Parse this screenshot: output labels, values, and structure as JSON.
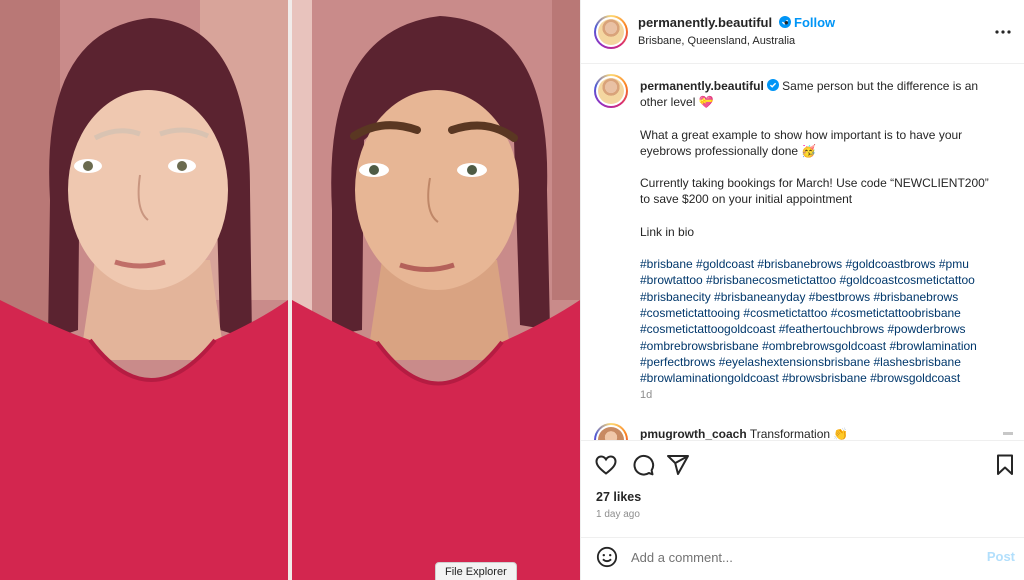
{
  "post": {
    "username": "permanently.beautiful",
    "follow_label": "Follow",
    "dot": "•",
    "location": "Brisbane, Queensland, Australia"
  },
  "caption": {
    "username": "permanently.beautiful",
    "line1": "Same person but the difference is an other level 💝",
    "line2": "What a great example to show how important is to have your eyebrows professionally done 🥳",
    "line3": "Currently taking bookings for March! Use code “NEWCLIENT200” to save $200 on your initial appointment",
    "line4": "Link in bio",
    "hashtags": "#brisbane #goldcoast #brisbanebrows #goldcoastbrows #pmu #browtattoo #brisbanecosmetictattoo #goldcoastcosmetictattoo #brisbanecity #brisbaneanyday #bestbrows #brisbanebrows #cosmetictattooing #cosmetictattoo #cosmetictattoobrisbane #cosmetictattoogoldcoast #feathertouchbrows #powderbrows #ombrebrowsbrisbane #ombrebrowsgoldcoast #browlamination #perfectbrows #eyelashextensionsbrisbane #lashesbrisbane #browlaminationgoldcoast #browsbrisbane #browsgoldcoast",
    "age": "1d"
  },
  "reply": {
    "username": "pmugrowth_coach",
    "text": "Transformation 👏"
  },
  "stats": {
    "likes": "27 likes",
    "time": "1 day ago"
  },
  "comment_box": {
    "placeholder": "Add a comment...",
    "post_label": "Post"
  },
  "taskbar_tooltip": "File Explorer",
  "colors": {
    "accent": "#0095f6",
    "hashtag": "#00376b",
    "shirt": "#d3264f",
    "wall": "#c98b8a"
  },
  "icons": [
    "verified-badge-icon",
    "more-options-icon",
    "heart-icon",
    "comment-icon",
    "share-icon",
    "bookmark-icon",
    "emoji-icon"
  ]
}
